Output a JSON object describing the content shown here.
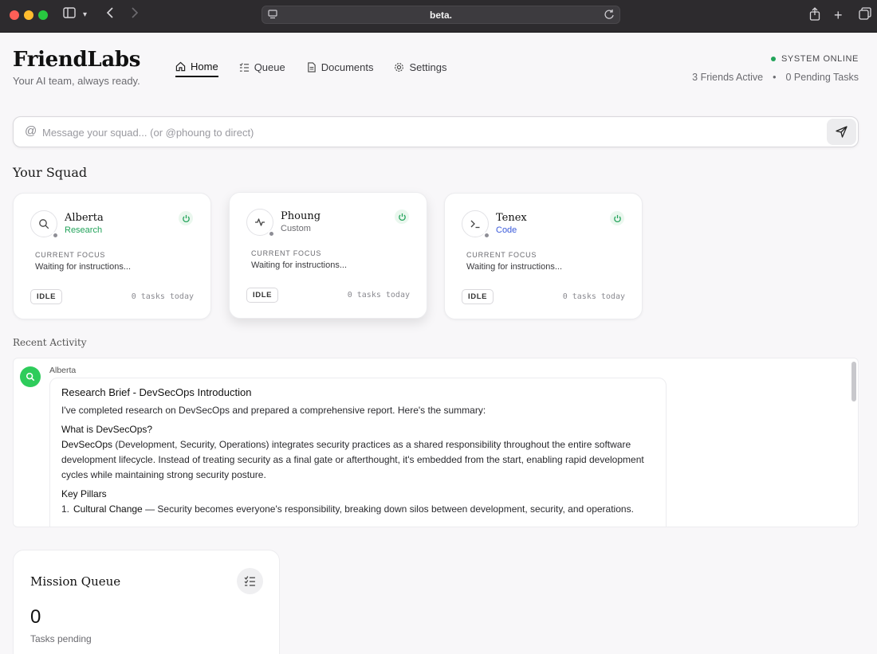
{
  "browser": {
    "url": "beta."
  },
  "brand": {
    "title": "FriendLabs",
    "tagline": "Your AI team, always ready."
  },
  "nav": {
    "items": [
      {
        "label": "Home",
        "icon": "home-icon",
        "active": true
      },
      {
        "label": "Queue",
        "icon": "queue-icon",
        "active": false
      },
      {
        "label": "Documents",
        "icon": "document-icon",
        "active": false
      },
      {
        "label": "Settings",
        "icon": "gear-icon",
        "active": false
      }
    ]
  },
  "status": {
    "online": "SYSTEM ONLINE",
    "friends_active": "3 Friends Active",
    "separator": "•",
    "pending": "0 Pending Tasks",
    "online_color": "#22a35a"
  },
  "message_input": {
    "placeholder": "Message your squad... (or @phoung to direct)",
    "value": ""
  },
  "squad": {
    "title": "Your Squad",
    "focus_label": "CURRENT FOCUS",
    "friends": [
      {
        "name": "Alberta",
        "role": "Research",
        "role_color": "#22a35a",
        "icon": "search-icon",
        "focus": "Waiting for instructions...",
        "status": "IDLE",
        "tasks": "0 tasks today"
      },
      {
        "name": "Phoung",
        "role": "Custom",
        "role_color": "#6b6b70",
        "icon": "activity-icon",
        "focus": "Waiting for instructions...",
        "status": "IDLE",
        "tasks": "0 tasks today"
      },
      {
        "name": "Tenex",
        "role": "Code",
        "role_color": "#3b5bdb",
        "icon": "terminal-icon",
        "focus": "Waiting for instructions...",
        "status": "IDLE",
        "tasks": "0 tasks today"
      }
    ]
  },
  "activity": {
    "title": "Recent Activity",
    "author": "Alberta",
    "message": {
      "heading": "Research Brief - DevSecOps Introduction",
      "intro": "I've completed research on DevSecOps and prepared a comprehensive report. Here's the summary:",
      "subheading": "What is DevSecOps?",
      "term": "DevSecOps",
      "definition": " (Development, Security, Operations) integrates security practices as a shared responsibility throughout the entire software development lifecycle. Instead of treating security as a final gate or afterthought, it's embedded from the start, enabling rapid development cycles while maintaining strong security posture.",
      "pillars_heading": "Key Pillars",
      "pillars": [
        {
          "num": "1.",
          "term": "Cultural Change",
          "text": " — Security becomes everyone's responsibility, breaking down silos between development, security, and operations."
        }
      ]
    }
  },
  "mission_queue": {
    "title": "Mission Queue",
    "count": "0",
    "label": "Tasks pending"
  }
}
